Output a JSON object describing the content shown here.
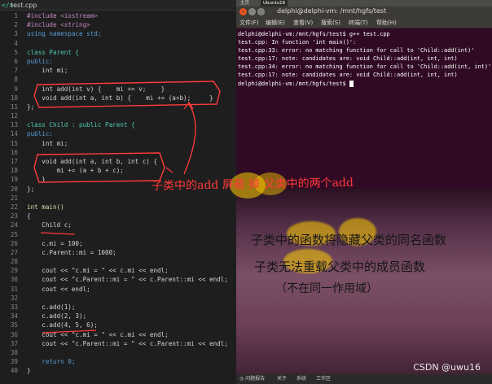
{
  "editor": {
    "tab_label": "test.cpp",
    "lines": [
      {
        "n": "1",
        "text": "#include <iostream>",
        "cls": "pp"
      },
      {
        "n": "2",
        "text": "#include <string>",
        "cls": "pp"
      },
      {
        "n": "3",
        "text": "using namespace std;",
        "cls": "k"
      },
      {
        "n": "4",
        "text": "",
        "cls": ""
      },
      {
        "n": "5",
        "text": "class Parent {",
        "cls": "ty"
      },
      {
        "n": "6",
        "text": "public:",
        "cls": "k"
      },
      {
        "n": "7",
        "text": "    int mi;",
        "cls": ""
      },
      {
        "n": "8",
        "text": "",
        "cls": ""
      },
      {
        "n": "9",
        "text": "    int add(int v) {    mi += v;    }",
        "cls": ""
      },
      {
        "n": "10",
        "text": "    void add(int a, int b) {    mi += (a+b);     }",
        "cls": ""
      },
      {
        "n": "11",
        "text": "};",
        "cls": ""
      },
      {
        "n": "12",
        "text": "",
        "cls": ""
      },
      {
        "n": "13",
        "text": "class Child : public Parent {",
        "cls": "ty"
      },
      {
        "n": "14",
        "text": "public:",
        "cls": "k"
      },
      {
        "n": "15",
        "text": "    int mi;",
        "cls": ""
      },
      {
        "n": "16",
        "text": "",
        "cls": ""
      },
      {
        "n": "17",
        "text": "    void add(int a, int b, int c) {",
        "cls": ""
      },
      {
        "n": "18",
        "text": "        mi += (a + b + c);",
        "cls": ""
      },
      {
        "n": "19",
        "text": "    }",
        "cls": ""
      },
      {
        "n": "20",
        "text": "};",
        "cls": ""
      },
      {
        "n": "21",
        "text": "",
        "cls": ""
      },
      {
        "n": "22",
        "text": "int main()",
        "cls": "fn"
      },
      {
        "n": "23",
        "text": "{",
        "cls": ""
      },
      {
        "n": "24",
        "text": "    Child c;",
        "cls": ""
      },
      {
        "n": "25",
        "text": "",
        "cls": ""
      },
      {
        "n": "26",
        "text": "    c.mi = 100;",
        "cls": ""
      },
      {
        "n": "27",
        "text": "    c.Parent::mi = 1000;",
        "cls": ""
      },
      {
        "n": "28",
        "text": "",
        "cls": ""
      },
      {
        "n": "29",
        "text": "    cout << \"c.mi = \" << c.mi << endl;",
        "cls": ""
      },
      {
        "n": "30",
        "text": "    cout << \"c.Parent::mi = \" << c.Parent::mi << endl;",
        "cls": ""
      },
      {
        "n": "31",
        "text": "    cout << endl;",
        "cls": ""
      },
      {
        "n": "32",
        "text": "",
        "cls": ""
      },
      {
        "n": "33",
        "text": "    c.add(1);",
        "cls": ""
      },
      {
        "n": "34",
        "text": "    c.add(2, 3);",
        "cls": ""
      },
      {
        "n": "35",
        "text": "    c.add(4, 5, 6);",
        "cls": ""
      },
      {
        "n": "36",
        "text": "    cout << \"c.mi = \" << c.mi << endl;",
        "cls": ""
      },
      {
        "n": "37",
        "text": "    cout << \"c.Parent::mi = \" << c.Parent::mi << endl;",
        "cls": ""
      },
      {
        "n": "38",
        "text": "",
        "cls": ""
      },
      {
        "n": "39",
        "text": "    return 0;",
        "cls": "k"
      },
      {
        "n": "40",
        "text": "}",
        "cls": ""
      }
    ],
    "annotation": "子类中的add 屏蔽 掉 父类中的两个add"
  },
  "terminal": {
    "top_tabs": [
      "主页",
      "Ubuntu16"
    ],
    "window_title": "delphi@delphi-vm: /mnt/hgfs/test",
    "menu": [
      "文件(F)",
      "编辑(E)",
      "查看(V)",
      "搜索(S)",
      "终端(T)",
      "帮助(H)"
    ],
    "output": [
      "delphi@delphi-vm:/mnt/hgfs/test$ g++ test.cpp",
      "test.cpp: In function 'int main()':",
      "test.cpp:33: error: no matching function for call to 'Child::add(int)'",
      "test.cpp:17: note: candidates are: void Child::add(int, int, int)",
      "test.cpp:34: error: no matching function for call to 'Child::add(int, int)'",
      "test.cpp:17: note: candidates are: void Child::add(int, int, int)",
      "delphi@delphi-vm:/mnt/hgfs/test$ "
    ]
  },
  "notes": {
    "line1": "子类中的函数将隐藏父类的同名函数",
    "line2": "子类无法重载父类中的成员函数",
    "line3": "（不在同一作用域）",
    "taskbar": [
      "◎ 问题报告",
      "关于",
      "系统",
      "工作区"
    ],
    "watermark": "CSDN @uwu16"
  },
  "colors": {
    "editor_bg": "#1e1e1e",
    "annotation": "#ff3a3a",
    "highlight": "#ffd000",
    "terminal_bg": "#300a24",
    "ubuntu_orange": "#e95420"
  }
}
